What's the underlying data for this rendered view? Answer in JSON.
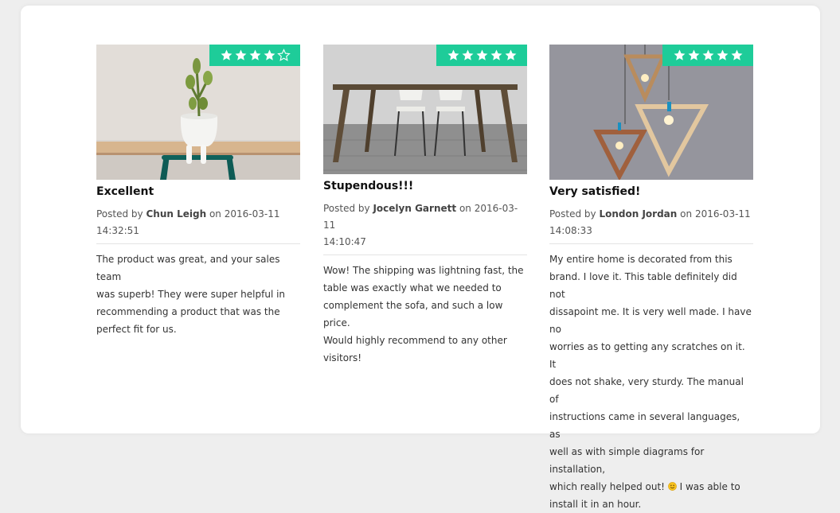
{
  "colors": {
    "page_bg": "#eeeeee",
    "panel_bg": "#ffffff",
    "rating_badge": "#1ecc99",
    "title": "#111111",
    "meta": "#555555",
    "body": "#333333"
  },
  "reviews": [
    {
      "rating": 4,
      "max_rating": 5,
      "image_subject": "succulent in white planter on wooden shelf",
      "title": "Excellent",
      "posted_by_label": "Posted by",
      "author": "Chun Leigh",
      "on_label": "on",
      "date": "2016-03-11",
      "time": "14:32:51",
      "body": "The product was great, and your sales team\nwas superb! They were super helpful in\nrecommending a product that was the\nperfect fit for us."
    },
    {
      "rating": 5,
      "max_rating": 5,
      "image_subject": "wooden dining table with two white chairs",
      "title": "Stupendous!!!",
      "posted_by_label": "Posted by",
      "author": "Jocelyn Garnett",
      "on_label": "on",
      "date": "2016-03-11",
      "time": "14:10:47",
      "body": "Wow! The shipping was lightning fast, the\ntable was exactly what we needed to\ncomplement the sofa, and such a low price.\nWould highly recommend to any other\nvisitors!"
    },
    {
      "rating": 5,
      "max_rating": 5,
      "image_subject": "geometric wooden triangle pendant lamps",
      "title": "Very satisfied!",
      "posted_by_label": "Posted by",
      "author": "London Jordan",
      "on_label": "on",
      "date": "2016-03-11",
      "time": "14:08:33",
      "body_before_emoji": "My entire home is decorated from this\nbrand. I love it. This table definitely did not\ndissapoint me. It is very well made. I have no\nworries as to getting any scratches on it. It\ndoes not shake, very sturdy. The manual of\ninstructions came in several languages, as\nwell as with simple diagrams for installation,\nwhich really helped out! ",
      "emoji": "smiley-icon",
      "body_after_emoji": " I was able to\ninstall it in an hour."
    }
  ]
}
